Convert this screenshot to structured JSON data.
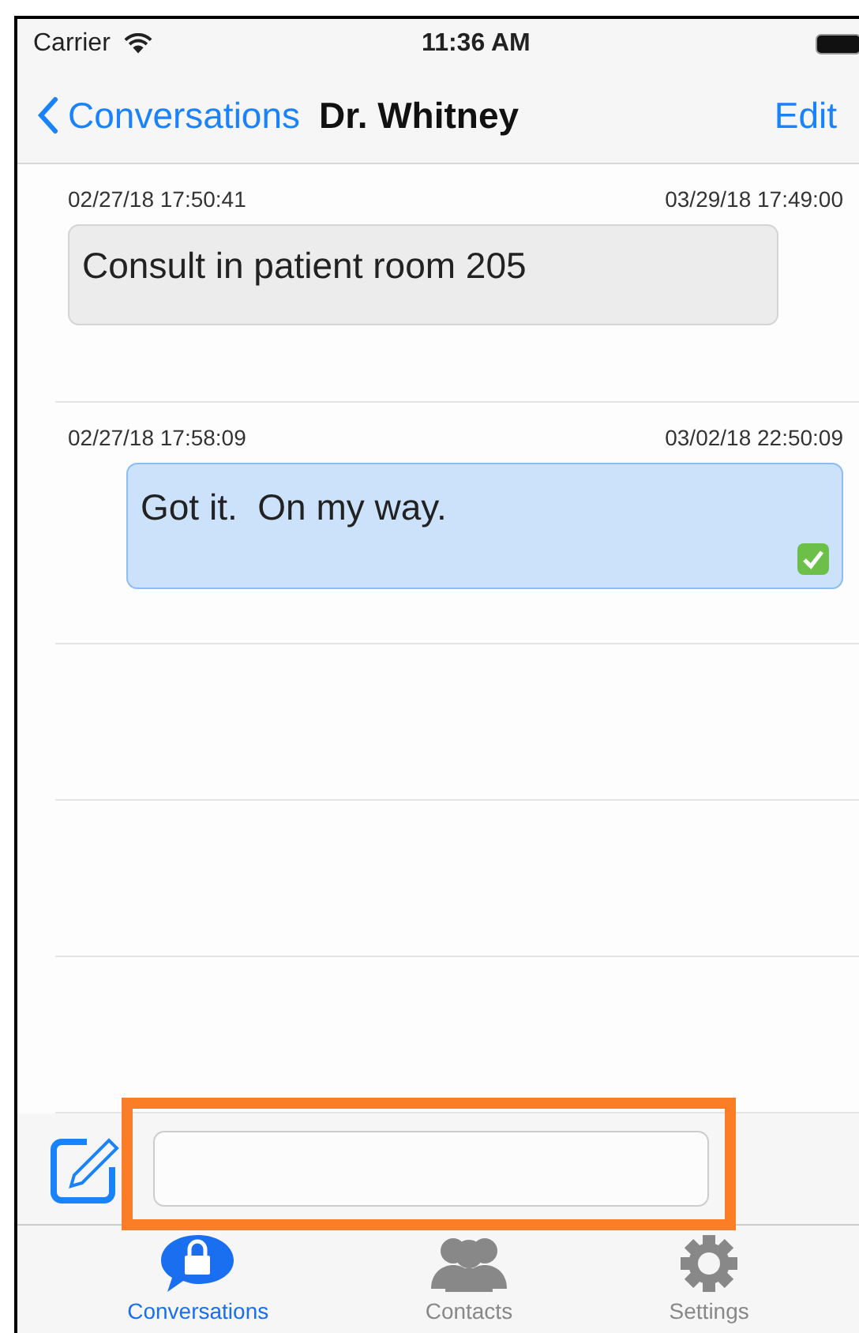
{
  "status_bar": {
    "carrier": "Carrier",
    "time": "11:36 AM"
  },
  "nav": {
    "back": "Conversations",
    "title": "Dr. Whitney",
    "action": "Edit"
  },
  "messages": [
    {
      "sent": "02/27/18 17:50:41",
      "received": "03/29/18 17:49:00",
      "text": "Consult in patient room 205",
      "kind": "incoming",
      "delivered": false
    },
    {
      "sent": "02/27/18 17:58:09",
      "received": "03/02/18 22:50:09",
      "text": "Got it.  On my way.",
      "kind": "outgoing",
      "delivered": true
    }
  ],
  "compose": {
    "highlighted": true
  },
  "tabs": [
    {
      "label": "Conversations",
      "kind": "chat",
      "selected": true
    },
    {
      "label": "Contacts",
      "kind": "people",
      "selected": false
    },
    {
      "label": "Settings",
      "kind": "gear",
      "selected": false
    }
  ]
}
